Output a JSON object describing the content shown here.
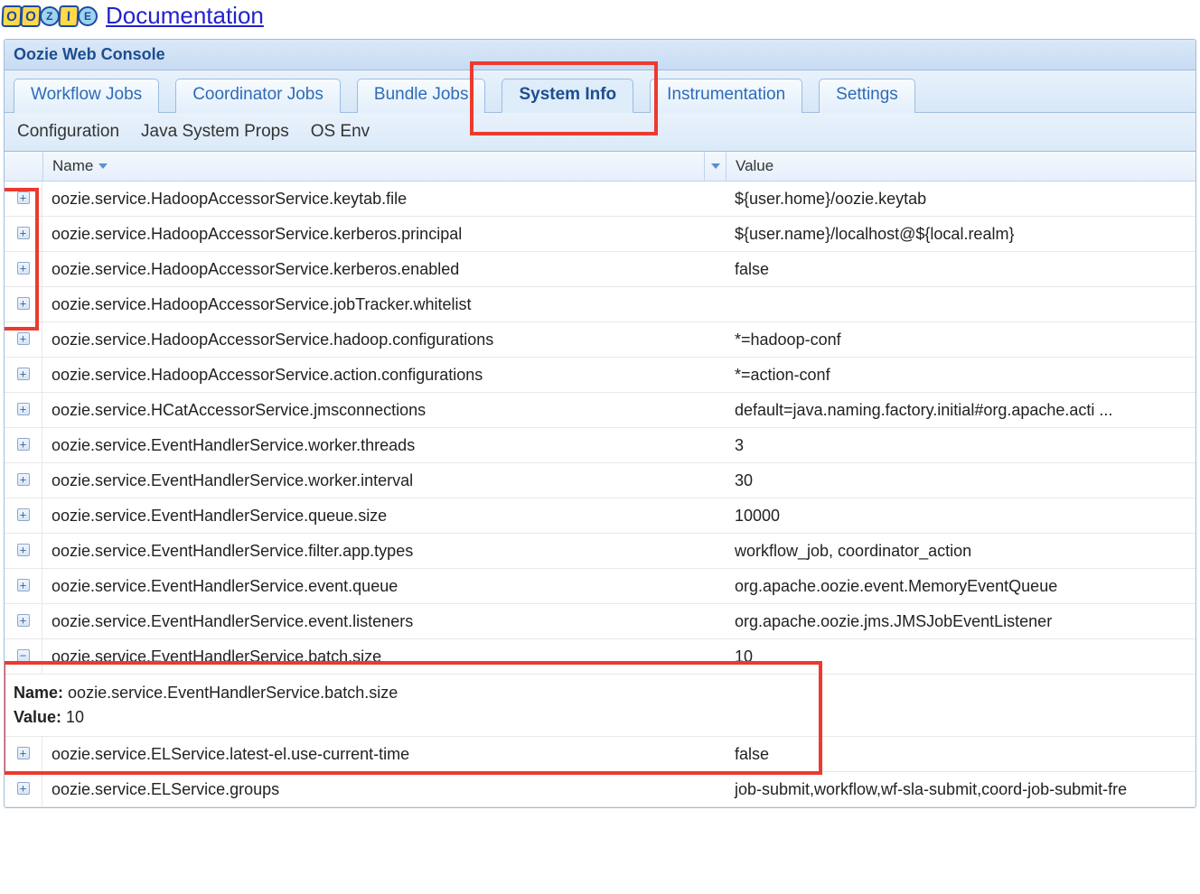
{
  "header": {
    "logo_letters": [
      "O",
      "O",
      "Z",
      "I",
      "E"
    ],
    "doc_link_text": "Documentation"
  },
  "panel": {
    "title": "Oozie Web Console"
  },
  "tabs": [
    {
      "label": "Workflow Jobs",
      "active": false
    },
    {
      "label": "Coordinator Jobs",
      "active": false
    },
    {
      "label": "Bundle Jobs",
      "active": false
    },
    {
      "label": "System Info",
      "active": true
    },
    {
      "label": "Instrumentation",
      "active": false
    },
    {
      "label": "Settings",
      "active": false
    }
  ],
  "subtabs": [
    {
      "label": "Configuration"
    },
    {
      "label": "Java System Props"
    },
    {
      "label": "OS Env"
    }
  ],
  "grid": {
    "columns": {
      "name": "Name",
      "value": "Value"
    },
    "rows": [
      {
        "name": "oozie.service.HadoopAccessorService.keytab.file",
        "value": "${user.home}/oozie.keytab",
        "expanded": false
      },
      {
        "name": "oozie.service.HadoopAccessorService.kerberos.principal",
        "value": "${user.name}/localhost@${local.realm}",
        "expanded": false
      },
      {
        "name": "oozie.service.HadoopAccessorService.kerberos.enabled",
        "value": "false",
        "expanded": false
      },
      {
        "name": "oozie.service.HadoopAccessorService.jobTracker.whitelist",
        "value": "",
        "expanded": false
      },
      {
        "name": "oozie.service.HadoopAccessorService.hadoop.configurations",
        "value": "*=hadoop-conf",
        "expanded": false
      },
      {
        "name": "oozie.service.HadoopAccessorService.action.configurations",
        "value": "*=action-conf",
        "expanded": false
      },
      {
        "name": "oozie.service.HCatAccessorService.jmsconnections",
        "value": "default=java.naming.factory.initial#org.apache.acti ...",
        "expanded": false
      },
      {
        "name": "oozie.service.EventHandlerService.worker.threads",
        "value": "3",
        "expanded": false
      },
      {
        "name": "oozie.service.EventHandlerService.worker.interval",
        "value": "30",
        "expanded": false
      },
      {
        "name": "oozie.service.EventHandlerService.queue.size",
        "value": "10000",
        "expanded": false
      },
      {
        "name": "oozie.service.EventHandlerService.filter.app.types",
        "value": "workflow_job, coordinator_action",
        "expanded": false
      },
      {
        "name": "oozie.service.EventHandlerService.event.queue",
        "value": "org.apache.oozie.event.MemoryEventQueue",
        "expanded": false
      },
      {
        "name": "oozie.service.EventHandlerService.event.listeners",
        "value": "org.apache.oozie.jms.JMSJobEventListener",
        "expanded": false
      },
      {
        "name": "oozie.service.EventHandlerService.batch.size",
        "value": "10",
        "expanded": true,
        "detail": {
          "name_label": "Name:",
          "name_value": "oozie.service.EventHandlerService.batch.size",
          "value_label": "Value:",
          "value_value": "10"
        }
      },
      {
        "name": "oozie.service.ELService.latest-el.use-current-time",
        "value": "false",
        "expanded": false
      },
      {
        "name": "oozie.service.ELService.groups",
        "value": "job-submit,workflow,wf-sla-submit,coord-job-submit-fre",
        "expanded": false
      }
    ]
  }
}
